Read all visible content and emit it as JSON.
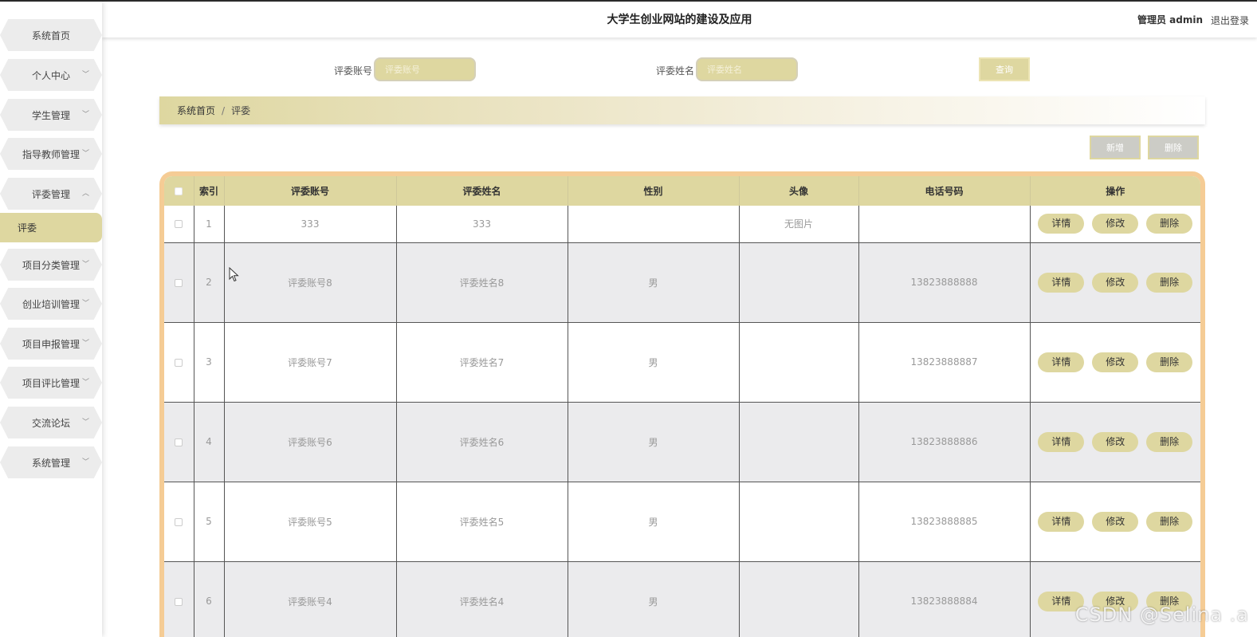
{
  "header": {
    "title": "大学生创业网站的建设及应用",
    "role": "管理员 admin",
    "logout": "退出登录"
  },
  "sidebar": {
    "items": [
      {
        "label": "系统首页",
        "has_chevron": false
      },
      {
        "label": "个人中心",
        "has_chevron": true
      },
      {
        "label": "学生管理",
        "has_chevron": true
      },
      {
        "label": "指导教师管理",
        "has_chevron": true
      },
      {
        "label": "评委管理",
        "has_chevron": true,
        "expanded": true
      },
      {
        "label": "项目分类管理",
        "has_chevron": true
      },
      {
        "label": "创业培训管理",
        "has_chevron": true
      },
      {
        "label": "项目申报管理",
        "has_chevron": true
      },
      {
        "label": "项目评比管理",
        "has_chevron": true
      },
      {
        "label": "交流论坛",
        "has_chevron": true
      },
      {
        "label": "系统管理",
        "has_chevron": true
      }
    ],
    "active_sub": "评委"
  },
  "search": {
    "account_label": "评委账号",
    "account_placeholder": "评委账号",
    "name_label": "评委姓名",
    "name_placeholder": "评委姓名",
    "query_label": "查询"
  },
  "breadcrumb": {
    "home": "系统首页",
    "separator": "/",
    "current": "评委"
  },
  "actions": {
    "add_label": "新增",
    "delete_label": "删除"
  },
  "table": {
    "headers": [
      "索引",
      "评委账号",
      "评委姓名",
      "性别",
      "头像",
      "电话号码",
      "操作"
    ],
    "op_labels": {
      "detail": "详情",
      "edit": "修改",
      "delete": "删除"
    },
    "rows": [
      {
        "index": "1",
        "account": "333",
        "name": "333",
        "gender": "",
        "avatar": "无图片",
        "phone": ""
      },
      {
        "index": "2",
        "account": "评委账号8",
        "name": "评委姓名8",
        "gender": "男",
        "avatar": "",
        "phone": "13823888888"
      },
      {
        "index": "3",
        "account": "评委账号7",
        "name": "评委姓名7",
        "gender": "男",
        "avatar": "",
        "phone": "13823888887"
      },
      {
        "index": "4",
        "account": "评委账号6",
        "name": "评委姓名6",
        "gender": "男",
        "avatar": "",
        "phone": "13823888886"
      },
      {
        "index": "5",
        "account": "评委账号5",
        "name": "评委姓名5",
        "gender": "男",
        "avatar": "",
        "phone": "13823888885"
      },
      {
        "index": "6",
        "account": "评委账号4",
        "name": "评委姓名4",
        "gender": "男",
        "avatar": "",
        "phone": "13823888884"
      }
    ]
  },
  "watermark": "CSDN @Selina .a",
  "colors": {
    "accent": "#ded7a0",
    "table_border": "#f5cc95",
    "menu_bg": "#ececec",
    "row_alt": "#ebebed"
  },
  "icons": {
    "chevron_down": "chevron-down-icon",
    "chevron_up": "chevron-up-icon",
    "cursor": "mouse-cursor-icon"
  }
}
